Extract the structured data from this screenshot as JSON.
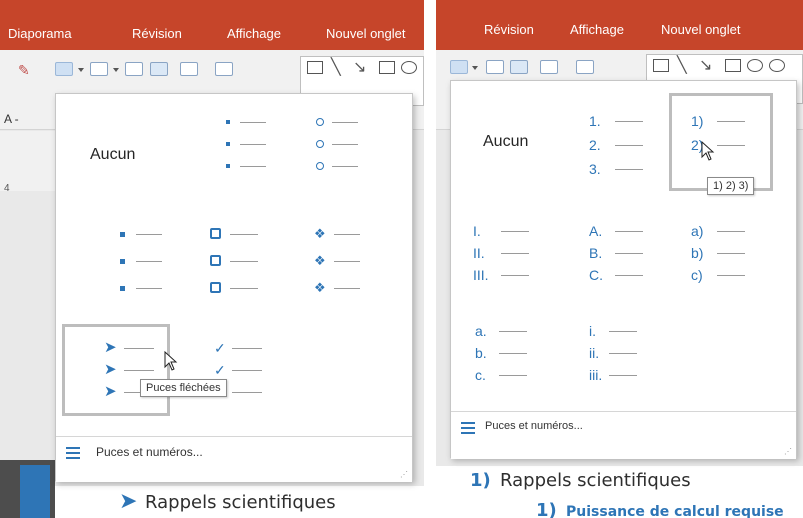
{
  "left_panel": {
    "tabs": [
      "Diaporama",
      "Révision",
      "Affichage",
      "Nouvel onglet"
    ],
    "ribbon_side_labels": [
      "A -",
      "4"
    ],
    "dropdown": {
      "none_label": "Aucun",
      "bullet_glyphs": {
        "dot": "•",
        "circle": "○",
        "square": "◆",
        "hollow_square": "❑",
        "diamond": "❖",
        "arrow": "➤",
        "check": "✓"
      },
      "tooltip": "Puces fléchées",
      "footer_label": "Puces et numéros..."
    },
    "doc_heading": "Rappels scientifiques"
  },
  "right_panel": {
    "tabs": [
      "Révision",
      "Affichage",
      "Nouvel onglet"
    ],
    "dropdown": {
      "none_label": "Aucun",
      "numbering": {
        "arabic_dot": [
          "1.",
          "2.",
          "3."
        ],
        "arabic_paren": [
          "1)",
          "2)",
          "3)"
        ],
        "roman_upper": [
          "I.",
          "II.",
          "III."
        ],
        "alpha_upper": [
          "A.",
          "B.",
          "C."
        ],
        "alpha_paren": [
          "a)",
          "b)",
          "c)"
        ],
        "alpha_lower": [
          "a.",
          "b.",
          "c."
        ],
        "roman_lower": [
          "i.",
          "ii.",
          "iii."
        ]
      },
      "tooltip": "1) 2) 3)",
      "footer_label": "Puces et numéros..."
    },
    "doc_heading_number": "1)",
    "doc_heading": "Rappels scientifiques",
    "doc_subheading_number": "1)",
    "doc_subheading": "Puissance de calcul requise"
  },
  "colors": {
    "tab_bar": "#c6452a",
    "accent": "#2e75b6"
  }
}
